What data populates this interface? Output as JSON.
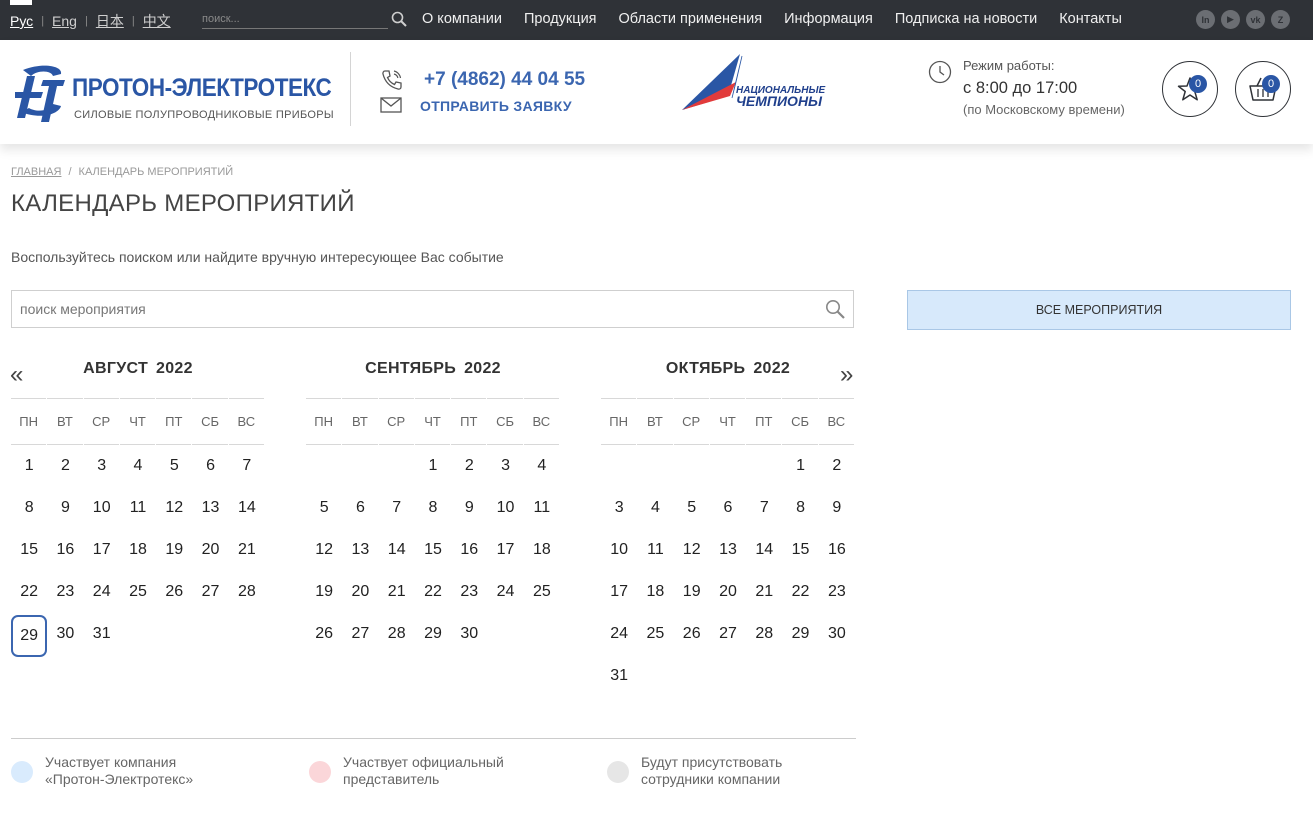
{
  "languages": [
    {
      "label": "Рус",
      "active": true
    },
    {
      "label": "Eng",
      "active": false
    },
    {
      "label": "日本",
      "active": false
    },
    {
      "label": "中文",
      "active": false
    }
  ],
  "top_search": {
    "placeholder": "поиск..."
  },
  "top_nav": [
    "О компании",
    "Продукция",
    "Области применения",
    "Информация",
    "Подписка на новости",
    "Контакты"
  ],
  "socials": [
    "In",
    "▶",
    "vk",
    "Z"
  ],
  "logo": {
    "title": "ПРОТОН-ЭЛЕКТРОТЕКС",
    "subtitle": "СИЛОВЫЕ ПОЛУПРОВОДНИКОВЫЕ ПРИБОРЫ"
  },
  "contact": {
    "phone": "+7 (4862) 44 04 55",
    "send_request": "ОТПРАВИТЬ ЗАЯВКУ"
  },
  "champions": {
    "line1": "НАЦИОНАЛЬНЫЕ",
    "line2": "ЧЕМПИОНЫ"
  },
  "work_hours": {
    "label": "Режим работы:",
    "hours": "с 8:00 до 17:00",
    "note": "(по Московскому времени)"
  },
  "favorites": {
    "count": "0"
  },
  "cart": {
    "count": "0"
  },
  "breadcrumb": {
    "home": "ГЛАВНАЯ",
    "separator": "/",
    "current": "КАЛЕНДАРЬ МЕРОПРИЯТИЙ"
  },
  "page_title": "КАЛЕНДАРЬ МЕРОПРИЯТИЙ",
  "intro": "Воспользуйтесь поиском или найдите вручную интересующее Вас событие",
  "event_search": {
    "placeholder": "поиск мероприятия"
  },
  "all_events_button": "ВСЕ МЕРОПРИЯТИЯ",
  "nav": {
    "prev": "«",
    "next": "»"
  },
  "weekdays": [
    "ПН",
    "ВТ",
    "СР",
    "ЧТ",
    "ПТ",
    "СБ",
    "ВС"
  ],
  "months": [
    {
      "name": "АВГУСТ",
      "year": "2022",
      "first_weekday": 0,
      "days": 31,
      "today": 29
    },
    {
      "name": "СЕНТЯБРЬ",
      "year": "2022",
      "first_weekday": 3,
      "days": 30,
      "today": null
    },
    {
      "name": "ОКТЯБРЬ",
      "year": "2022",
      "first_weekday": 5,
      "days": 31,
      "today": null
    }
  ],
  "legend": [
    {
      "text_line1": "Участвует компания",
      "text_line2": "«Протон-Электротекс»",
      "color": "#d9ebfd"
    },
    {
      "text_line1": "Участвует официальный",
      "text_line2": "представитель",
      "color": "#fbd6d9"
    },
    {
      "text_line1": "Будут присутствовать",
      "text_line2": "сотрудники компании",
      "color": "#e6e6e6"
    }
  ],
  "colors": {
    "brand_blue": "#2a56a5",
    "link_blue": "#3b66b0",
    "topbar": "#2f3237",
    "all_events_bg": "#d7e9fb"
  }
}
